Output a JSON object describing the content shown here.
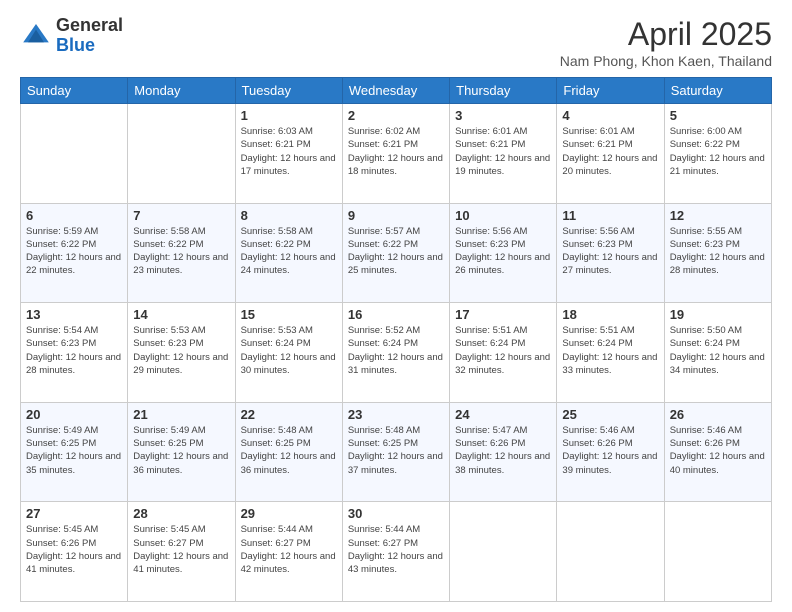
{
  "header": {
    "logo_general": "General",
    "logo_blue": "Blue",
    "title": "April 2025",
    "subtitle": "Nam Phong, Khon Kaen, Thailand"
  },
  "days_of_week": [
    "Sunday",
    "Monday",
    "Tuesday",
    "Wednesday",
    "Thursday",
    "Friday",
    "Saturday"
  ],
  "weeks": [
    [
      {
        "day": "",
        "sunrise": "",
        "sunset": "",
        "daylight": ""
      },
      {
        "day": "",
        "sunrise": "",
        "sunset": "",
        "daylight": ""
      },
      {
        "day": "1",
        "sunrise": "Sunrise: 6:03 AM",
        "sunset": "Sunset: 6:21 PM",
        "daylight": "Daylight: 12 hours and 17 minutes."
      },
      {
        "day": "2",
        "sunrise": "Sunrise: 6:02 AM",
        "sunset": "Sunset: 6:21 PM",
        "daylight": "Daylight: 12 hours and 18 minutes."
      },
      {
        "day": "3",
        "sunrise": "Sunrise: 6:01 AM",
        "sunset": "Sunset: 6:21 PM",
        "daylight": "Daylight: 12 hours and 19 minutes."
      },
      {
        "day": "4",
        "sunrise": "Sunrise: 6:01 AM",
        "sunset": "Sunset: 6:21 PM",
        "daylight": "Daylight: 12 hours and 20 minutes."
      },
      {
        "day": "5",
        "sunrise": "Sunrise: 6:00 AM",
        "sunset": "Sunset: 6:22 PM",
        "daylight": "Daylight: 12 hours and 21 minutes."
      }
    ],
    [
      {
        "day": "6",
        "sunrise": "Sunrise: 5:59 AM",
        "sunset": "Sunset: 6:22 PM",
        "daylight": "Daylight: 12 hours and 22 minutes."
      },
      {
        "day": "7",
        "sunrise": "Sunrise: 5:58 AM",
        "sunset": "Sunset: 6:22 PM",
        "daylight": "Daylight: 12 hours and 23 minutes."
      },
      {
        "day": "8",
        "sunrise": "Sunrise: 5:58 AM",
        "sunset": "Sunset: 6:22 PM",
        "daylight": "Daylight: 12 hours and 24 minutes."
      },
      {
        "day": "9",
        "sunrise": "Sunrise: 5:57 AM",
        "sunset": "Sunset: 6:22 PM",
        "daylight": "Daylight: 12 hours and 25 minutes."
      },
      {
        "day": "10",
        "sunrise": "Sunrise: 5:56 AM",
        "sunset": "Sunset: 6:23 PM",
        "daylight": "Daylight: 12 hours and 26 minutes."
      },
      {
        "day": "11",
        "sunrise": "Sunrise: 5:56 AM",
        "sunset": "Sunset: 6:23 PM",
        "daylight": "Daylight: 12 hours and 27 minutes."
      },
      {
        "day": "12",
        "sunrise": "Sunrise: 5:55 AM",
        "sunset": "Sunset: 6:23 PM",
        "daylight": "Daylight: 12 hours and 28 minutes."
      }
    ],
    [
      {
        "day": "13",
        "sunrise": "Sunrise: 5:54 AM",
        "sunset": "Sunset: 6:23 PM",
        "daylight": "Daylight: 12 hours and 28 minutes."
      },
      {
        "day": "14",
        "sunrise": "Sunrise: 5:53 AM",
        "sunset": "Sunset: 6:23 PM",
        "daylight": "Daylight: 12 hours and 29 minutes."
      },
      {
        "day": "15",
        "sunrise": "Sunrise: 5:53 AM",
        "sunset": "Sunset: 6:24 PM",
        "daylight": "Daylight: 12 hours and 30 minutes."
      },
      {
        "day": "16",
        "sunrise": "Sunrise: 5:52 AM",
        "sunset": "Sunset: 6:24 PM",
        "daylight": "Daylight: 12 hours and 31 minutes."
      },
      {
        "day": "17",
        "sunrise": "Sunrise: 5:51 AM",
        "sunset": "Sunset: 6:24 PM",
        "daylight": "Daylight: 12 hours and 32 minutes."
      },
      {
        "day": "18",
        "sunrise": "Sunrise: 5:51 AM",
        "sunset": "Sunset: 6:24 PM",
        "daylight": "Daylight: 12 hours and 33 minutes."
      },
      {
        "day": "19",
        "sunrise": "Sunrise: 5:50 AM",
        "sunset": "Sunset: 6:24 PM",
        "daylight": "Daylight: 12 hours and 34 minutes."
      }
    ],
    [
      {
        "day": "20",
        "sunrise": "Sunrise: 5:49 AM",
        "sunset": "Sunset: 6:25 PM",
        "daylight": "Daylight: 12 hours and 35 minutes."
      },
      {
        "day": "21",
        "sunrise": "Sunrise: 5:49 AM",
        "sunset": "Sunset: 6:25 PM",
        "daylight": "Daylight: 12 hours and 36 minutes."
      },
      {
        "day": "22",
        "sunrise": "Sunrise: 5:48 AM",
        "sunset": "Sunset: 6:25 PM",
        "daylight": "Daylight: 12 hours and 36 minutes."
      },
      {
        "day": "23",
        "sunrise": "Sunrise: 5:48 AM",
        "sunset": "Sunset: 6:25 PM",
        "daylight": "Daylight: 12 hours and 37 minutes."
      },
      {
        "day": "24",
        "sunrise": "Sunrise: 5:47 AM",
        "sunset": "Sunset: 6:26 PM",
        "daylight": "Daylight: 12 hours and 38 minutes."
      },
      {
        "day": "25",
        "sunrise": "Sunrise: 5:46 AM",
        "sunset": "Sunset: 6:26 PM",
        "daylight": "Daylight: 12 hours and 39 minutes."
      },
      {
        "day": "26",
        "sunrise": "Sunrise: 5:46 AM",
        "sunset": "Sunset: 6:26 PM",
        "daylight": "Daylight: 12 hours and 40 minutes."
      }
    ],
    [
      {
        "day": "27",
        "sunrise": "Sunrise: 5:45 AM",
        "sunset": "Sunset: 6:26 PM",
        "daylight": "Daylight: 12 hours and 41 minutes."
      },
      {
        "day": "28",
        "sunrise": "Sunrise: 5:45 AM",
        "sunset": "Sunset: 6:27 PM",
        "daylight": "Daylight: 12 hours and 41 minutes."
      },
      {
        "day": "29",
        "sunrise": "Sunrise: 5:44 AM",
        "sunset": "Sunset: 6:27 PM",
        "daylight": "Daylight: 12 hours and 42 minutes."
      },
      {
        "day": "30",
        "sunrise": "Sunrise: 5:44 AM",
        "sunset": "Sunset: 6:27 PM",
        "daylight": "Daylight: 12 hours and 43 minutes."
      },
      {
        "day": "",
        "sunrise": "",
        "sunset": "",
        "daylight": ""
      },
      {
        "day": "",
        "sunrise": "",
        "sunset": "",
        "daylight": ""
      },
      {
        "day": "",
        "sunrise": "",
        "sunset": "",
        "daylight": ""
      }
    ]
  ]
}
